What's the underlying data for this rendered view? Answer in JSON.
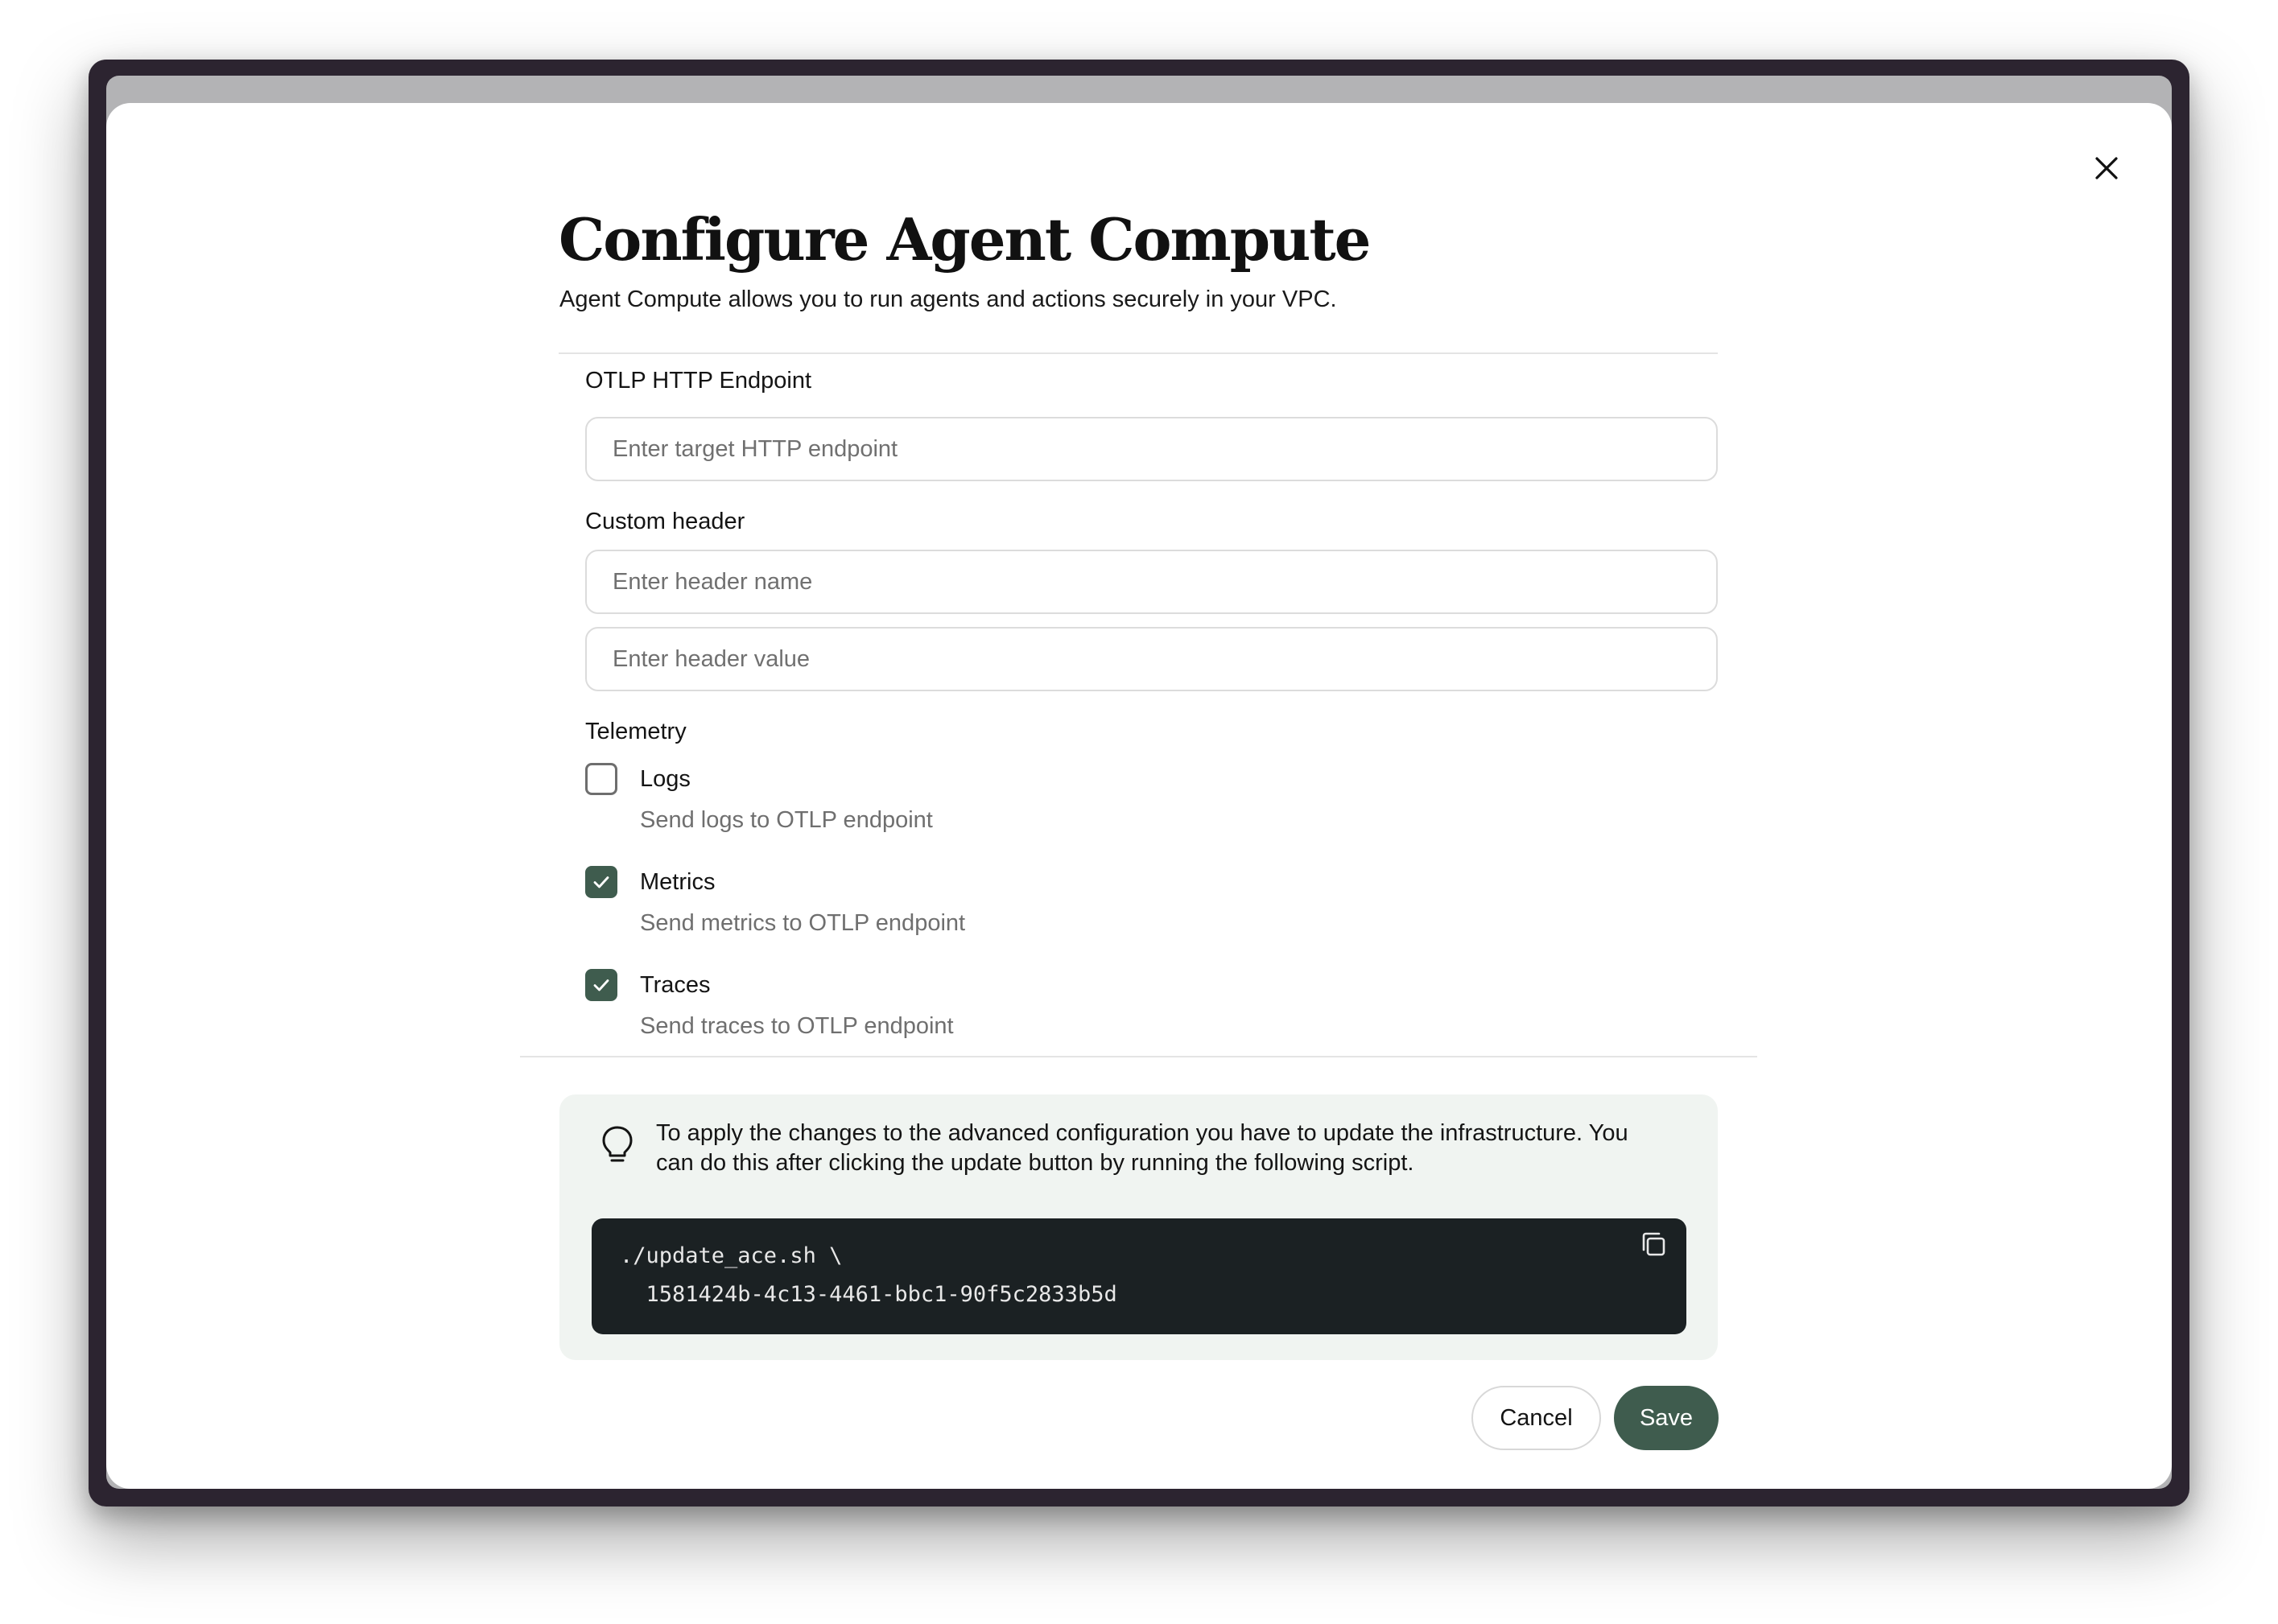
{
  "dialog": {
    "title": "Configure Agent Compute",
    "subtitle": "Agent Compute allows you to run agents and actions securely in your VPC.",
    "close_icon": "close-icon"
  },
  "endpoint": {
    "label": "OTLP HTTP Endpoint",
    "value": "",
    "placeholder": "Enter target HTTP endpoint"
  },
  "custom_header": {
    "label": "Custom header",
    "name_value": "",
    "name_placeholder": "Enter header name",
    "value_value": "",
    "value_placeholder": "Enter header value"
  },
  "telemetry": {
    "label": "Telemetry",
    "options": [
      {
        "label": "Logs",
        "description": "Send logs to OTLP endpoint",
        "checked": false
      },
      {
        "label": "Metrics",
        "description": "Send metrics to OTLP endpoint",
        "checked": true
      },
      {
        "label": "Traces",
        "description": "Send traces to OTLP endpoint",
        "checked": true
      }
    ]
  },
  "info": {
    "icon": "lightbulb-icon",
    "text": "To apply the changes to the advanced configuration you have to update the infrastructure. You can do this after clicking the update button by running the following script.",
    "code_line_1": "./update_ace.sh \\",
    "code_line_2": "  1581424b-4c13-4461-bbc1-90f5c2833b5d",
    "copy_icon": "copy-icon"
  },
  "actions": {
    "cancel_label": "Cancel",
    "save_label": "Save"
  },
  "colors": {
    "accent": "#3f5c4e",
    "info_background": "#f0f4f1",
    "code_background": "#1b2123"
  }
}
